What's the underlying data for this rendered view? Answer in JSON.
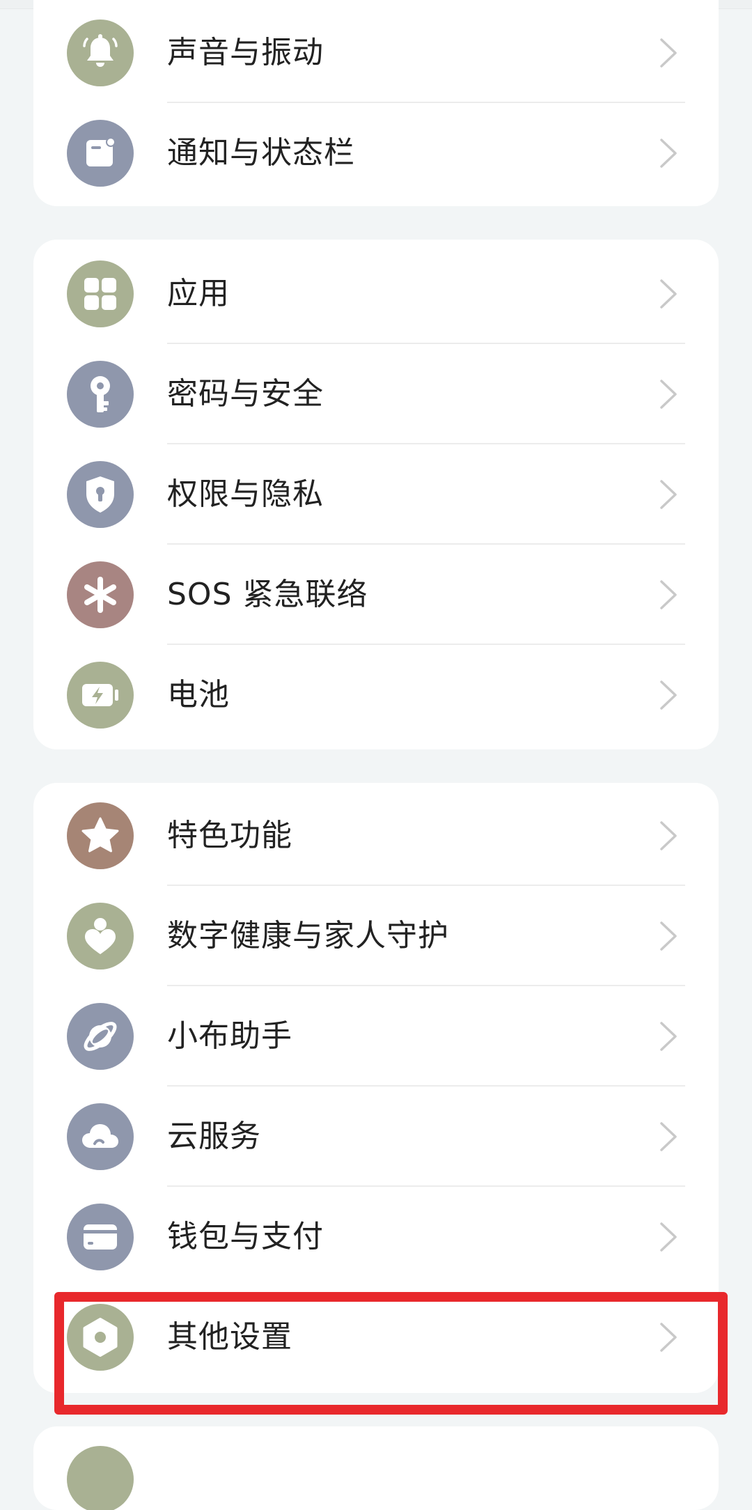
{
  "colors": {
    "background": "#f2f5f6",
    "card": "#ffffff",
    "icon_green": "#a9b193",
    "icon_blue": "#8f97ac",
    "icon_rose": "#a88582",
    "icon_brown": "#a68575",
    "highlight": "#e8282c"
  },
  "groups": [
    {
      "items": [
        {
          "label": "声音与振动",
          "icon": "bell-icon"
        },
        {
          "label": "通知与状态栏",
          "icon": "notification-icon"
        }
      ]
    },
    {
      "items": [
        {
          "label": "应用",
          "icon": "apps-grid-icon"
        },
        {
          "label": "密码与安全",
          "icon": "key-icon"
        },
        {
          "label": "权限与隐私",
          "icon": "shield-icon"
        },
        {
          "label": "SOS 紧急联络",
          "icon": "asterisk-icon"
        },
        {
          "label": "电池",
          "icon": "battery-icon"
        }
      ]
    },
    {
      "items": [
        {
          "label": "特色功能",
          "icon": "star-icon"
        },
        {
          "label": "数字健康与家人守护",
          "icon": "heart-person-icon"
        },
        {
          "label": "小布助手",
          "icon": "assistant-icon"
        },
        {
          "label": "云服务",
          "icon": "cloud-icon"
        },
        {
          "label": "钱包与支付",
          "icon": "wallet-card-icon"
        },
        {
          "label": "其他设置",
          "icon": "gear-icon"
        }
      ]
    }
  ]
}
